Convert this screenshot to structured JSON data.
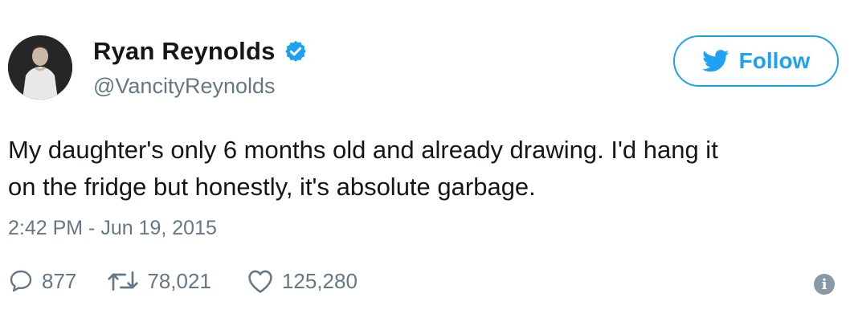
{
  "author": {
    "name": "Ryan Reynolds",
    "handle": "@VancityReynolds",
    "verified": true
  },
  "follow_button": {
    "label": "Follow",
    "icon": "twitter-bird-icon"
  },
  "tweet": {
    "line1": "My daughter's only 6 months old and already drawing. I'd hang it",
    "line2": "on the fridge but honestly, it's absolute garbage.",
    "timestamp": "2:42 PM - Jun 19, 2015"
  },
  "actions": {
    "replies": "877",
    "retweets": "78,021",
    "likes": "125,280"
  },
  "colors": {
    "accent": "#1da1f2",
    "text": "#14171a",
    "muted": "#657786"
  }
}
